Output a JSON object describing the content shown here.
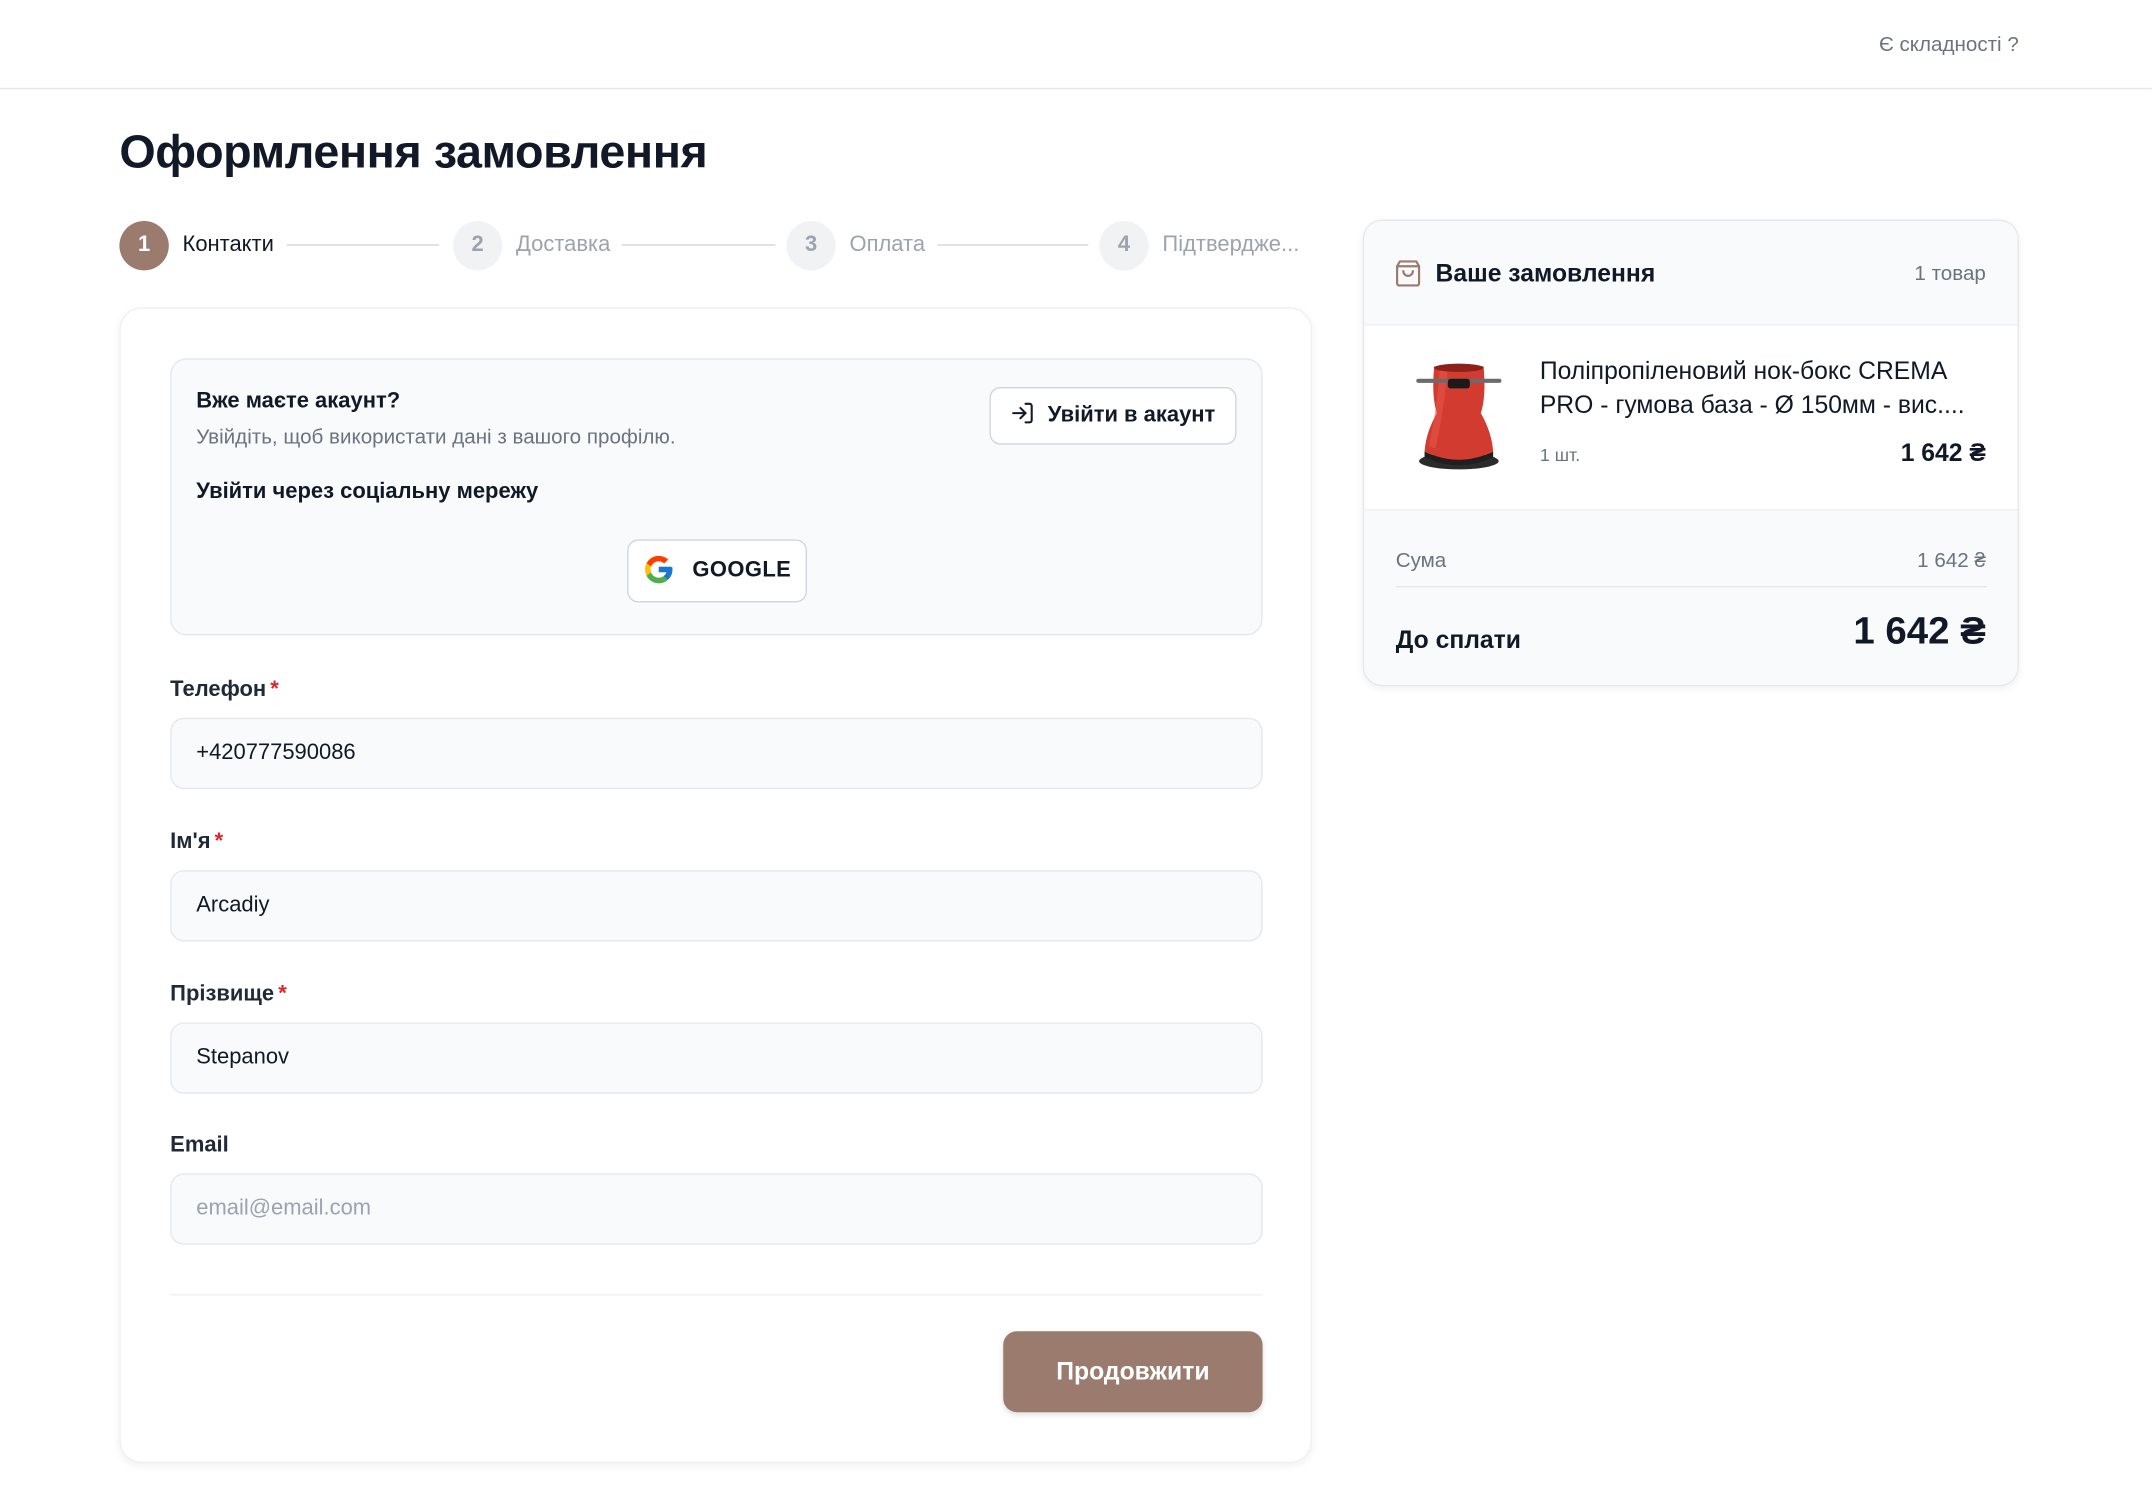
{
  "header": {
    "help_link": "Є складності ?"
  },
  "page": {
    "title": "Оформлення замовлення"
  },
  "steps": [
    {
      "number": "1",
      "label": "Контакти",
      "active": true
    },
    {
      "number": "2",
      "label": "Доставка",
      "active": false
    },
    {
      "number": "3",
      "label": "Оплата",
      "active": false
    },
    {
      "number": "4",
      "label": "Підтвердже...",
      "active": false
    }
  ],
  "account": {
    "title": "Вже маєте акаунт?",
    "subtitle": "Увійдіть, щоб використати дані з вашого профілю.",
    "login_button": "Увійти в акаунт",
    "social_title": "Увійти через соціальну мережу",
    "google_button": "GOOGLE"
  },
  "form": {
    "phone": {
      "label": "Телефон",
      "required_mark": "*",
      "value": "+420777590086"
    },
    "first_name": {
      "label": "Ім'я",
      "required_mark": "*",
      "value": "Arcadiy"
    },
    "last_name": {
      "label": "Прізвище",
      "required_mark": "*",
      "value": "Stepanov"
    },
    "email": {
      "label": "Email",
      "value": "",
      "placeholder": "email@email.com"
    },
    "continue_button": "Продовжити"
  },
  "order": {
    "title": "Ваше замовлення",
    "count": "1 товар",
    "item": {
      "name": "Поліпропіленовий нок-бокс CREMA PRO - гумова база - Ø 150мм - вис....",
      "qty": "1 шт.",
      "price": "1 642 ₴"
    },
    "sum_label": "Сума",
    "sum_value": "1 642 ₴",
    "total_label": "До сплати",
    "total_value": "1 642 ₴"
  },
  "colors": {
    "accent": "#9c7b6f",
    "required": "#dc2626",
    "muted": "#6b7280"
  },
  "icons": [
    "login-icon",
    "google-icon",
    "shopping-bag-icon"
  ]
}
